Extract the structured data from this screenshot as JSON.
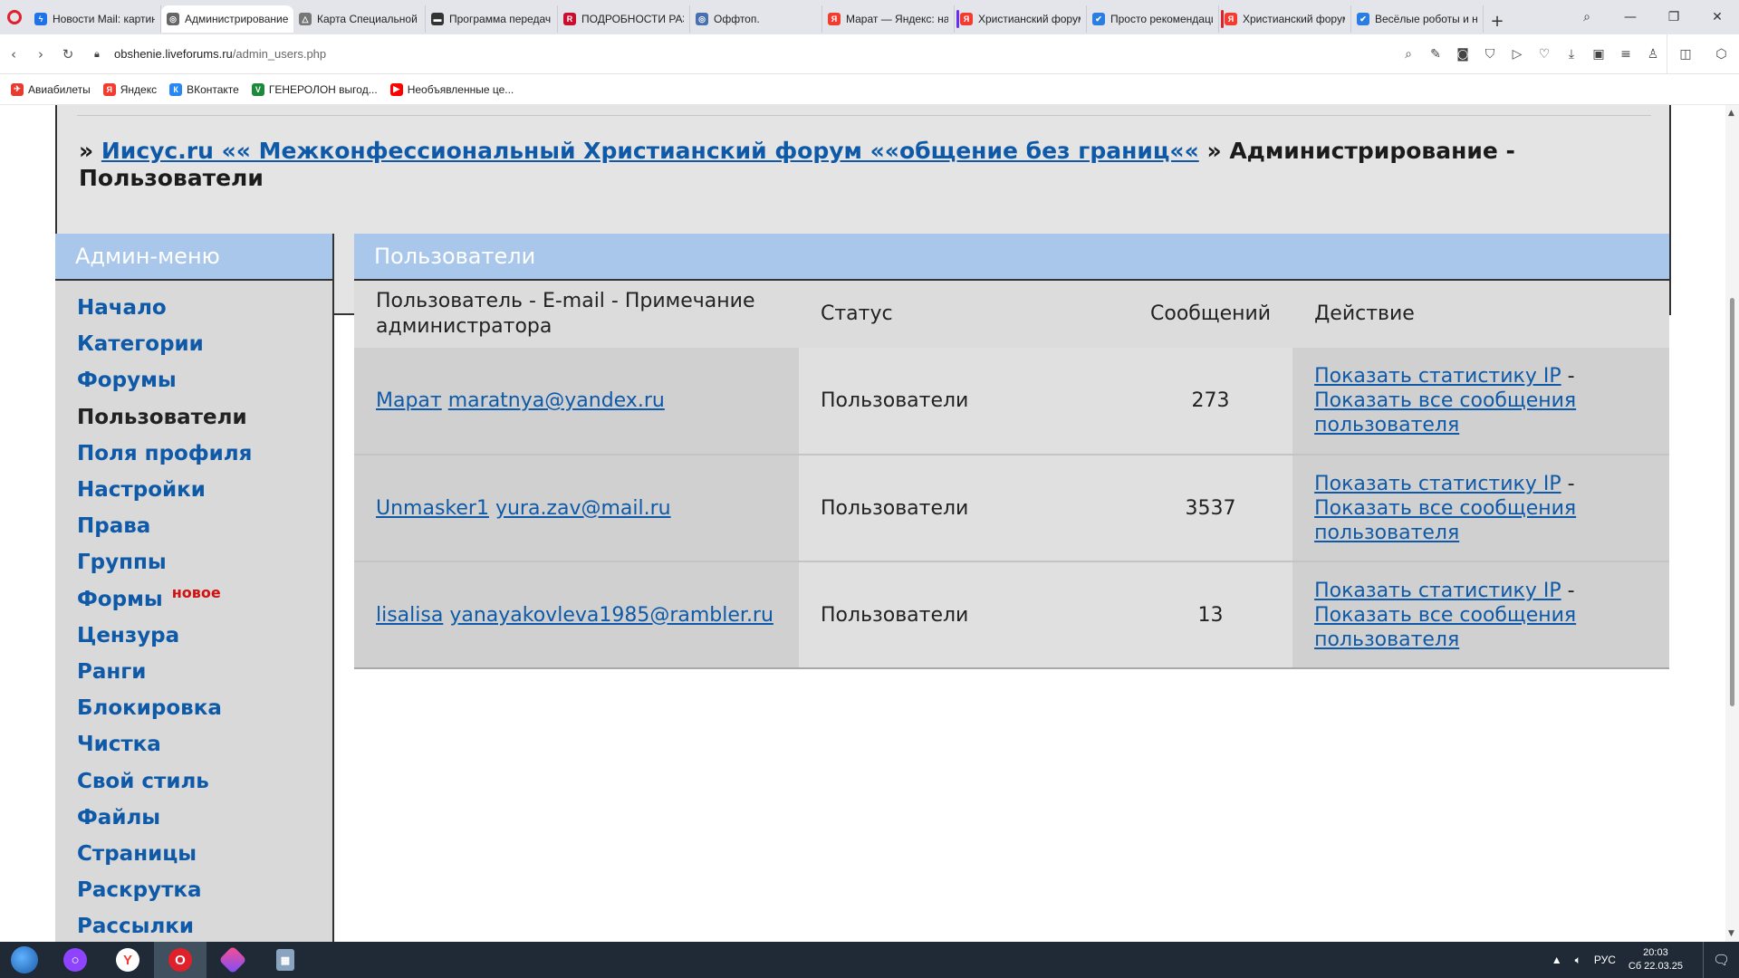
{
  "browser": {
    "tabs": [
      {
        "title": "Новости Mail: картин",
        "icon": "mail-news-icon",
        "color": "#1e73e8",
        "glyph": "ϟ"
      },
      {
        "title": "Администрирование - П",
        "icon": "site-icon",
        "color": "#666666",
        "glyph": "◎",
        "active": true
      },
      {
        "title": "Карта Специальной в",
        "icon": "map-icon",
        "color": "#777777",
        "glyph": "△"
      },
      {
        "title": "Программа передач",
        "icon": "tv-icon",
        "color": "#333333",
        "glyph": "▬"
      },
      {
        "title": "ПОДРОБНОСТИ РАЗГ",
        "icon": "news-r-icon",
        "color": "#c8102e",
        "glyph": "R"
      },
      {
        "title": "Оффтоп.",
        "icon": "forum-icon",
        "color": "#4a6fb0",
        "glyph": "◎"
      },
      {
        "title": "Марат — Яндекс: нац",
        "icon": "yandex-icon",
        "color": "#f23c2f",
        "glyph": "Я"
      },
      {
        "title": "Христианский форум",
        "icon": "yandex-icon",
        "color": "#f23c2f",
        "glyph": "Я",
        "mark": "#6b2df0"
      },
      {
        "title": "Просто рекомендаци",
        "icon": "check-icon",
        "color": "#2a7de1",
        "glyph": "✔"
      },
      {
        "title": "Христианский форум",
        "icon": "yandex-icon",
        "color": "#f23c2f",
        "glyph": "Я",
        "mark": "#e0202a"
      },
      {
        "title": "Весёлые роботы и не",
        "icon": "check-icon",
        "color": "#2a7de1",
        "glyph": "✔"
      }
    ],
    "url_host": "obshenie.liveforums.ru",
    "url_path": "/admin_users.php",
    "bookmarks": [
      {
        "label": "Авиабилеты",
        "color": "#e63b2e",
        "glyph": "✈"
      },
      {
        "label": "Яндекс",
        "color": "#f23c2f",
        "glyph": "Я"
      },
      {
        "label": "ВКонтакте",
        "color": "#2787f5",
        "glyph": "К"
      },
      {
        "label": "ГЕНЕРОЛОН выгод...",
        "color": "#1c8a3a",
        "glyph": "V"
      },
      {
        "label": "Необъявленные це...",
        "color": "#ff0000",
        "glyph": "▶"
      }
    ]
  },
  "breadcrumb": {
    "prefix": "»",
    "forum_link": "Иисус.ru «« Межконфессиональный Христианский форум ««общение без границ««",
    "sep": "»",
    "current": "Администрирование - Пользователи"
  },
  "admin_menu": {
    "title": "Админ-меню",
    "items": [
      {
        "label": "Начало"
      },
      {
        "label": "Категории"
      },
      {
        "label": "Форумы"
      },
      {
        "label": "Пользователи",
        "current": true
      },
      {
        "label": "Поля профиля"
      },
      {
        "label": "Настройки"
      },
      {
        "label": "Права"
      },
      {
        "label": "Группы"
      },
      {
        "label": "Формы",
        "badge": "новое"
      },
      {
        "label": "Цензура"
      },
      {
        "label": "Ранги"
      },
      {
        "label": "Блокировка"
      },
      {
        "label": "Чистка"
      },
      {
        "label": "Свой стиль"
      },
      {
        "label": "Файлы"
      },
      {
        "label": "Страницы"
      },
      {
        "label": "Раскрутка"
      },
      {
        "label": "Рассылки"
      }
    ]
  },
  "users_panel": {
    "title": "Пользователи",
    "columns": {
      "user": "Пользователь - E-mail - Примечание администратора",
      "status": "Статус",
      "posts": "Сообщений",
      "action": "Действие"
    },
    "rows": [
      {
        "name": "Марат",
        "email": "maratnya@yandex.ru",
        "status": "Пользователи",
        "posts": "273"
      },
      {
        "name": "Unmasker1",
        "email": "yura.zav@mail.ru",
        "status": "Пользователи",
        "posts": "3537"
      },
      {
        "name": "lisalisa",
        "email": "yanayakovleva1985@rambler.ru",
        "status": "Пользователи",
        "posts": "13"
      }
    ],
    "action_ip": "Показать статистику IP",
    "action_sep": "-",
    "action_posts": "Показать все сообщения пользователя"
  },
  "taskbar": {
    "lang": "РУС",
    "time": "20:03",
    "date": "Сб 22.03.25"
  }
}
